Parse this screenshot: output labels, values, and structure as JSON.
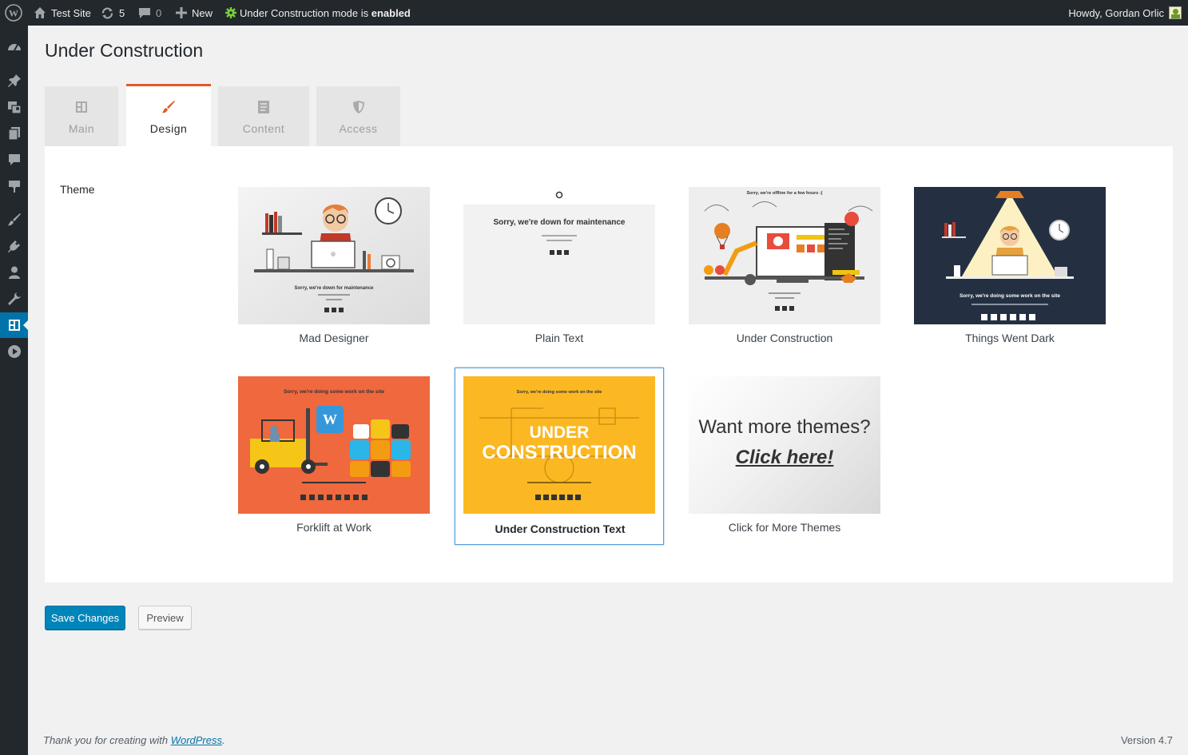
{
  "admin_bar": {
    "site_name": "Test Site",
    "updates_count": "5",
    "comments_count": "0",
    "new_label": "New",
    "uc_status_prefix": "Under Construction mode is ",
    "uc_status_state": "enabled",
    "greeting": "Howdy, Gordan Orlic"
  },
  "page": {
    "title": "Under Construction"
  },
  "tabs": [
    {
      "label": "Main",
      "icon": "layout-icon"
    },
    {
      "label": "Design",
      "icon": "brush-icon",
      "active": true
    },
    {
      "label": "Content",
      "icon": "document-icon"
    },
    {
      "label": "Access",
      "icon": "shield-icon"
    }
  ],
  "theme_section": {
    "label": "Theme",
    "themes": [
      {
        "caption": "Mad Designer",
        "thumb_headline": "Sorry, we're down for maintenance"
      },
      {
        "caption": "Plain Text",
        "thumb_headline": "Sorry, we're down for maintenance"
      },
      {
        "caption": "Under Construction",
        "thumb_headline": "Sorry, we're offline for a few hours :("
      },
      {
        "caption": "Things Went Dark",
        "thumb_headline": "Sorry, we're doing some work on the site"
      },
      {
        "caption": "Forklift at Work",
        "thumb_headline": "Sorry, we're doing some work on the site"
      },
      {
        "caption": "Under Construction Text",
        "thumb_headline": "Sorry, we're doing some work on the site",
        "thumb_big_text_1": "UNDER",
        "thumb_big_text_2": "CONSTRUCTION",
        "selected": true
      },
      {
        "caption": "Click for More Themes",
        "thumb_line1": "Want more themes?",
        "thumb_line2": "Click here!"
      }
    ]
  },
  "buttons": {
    "save": "Save Changes",
    "preview": "Preview"
  },
  "footer": {
    "thanks_prefix": "Thank you for creating with ",
    "wp_link": "WordPress",
    "thanks_suffix": ".",
    "version": "Version 4.7"
  },
  "colors": {
    "accent_orange": "#e05a2b",
    "wp_blue": "#0085ba",
    "admin_dark": "#23282d",
    "uc_green": "#7ad03a"
  }
}
